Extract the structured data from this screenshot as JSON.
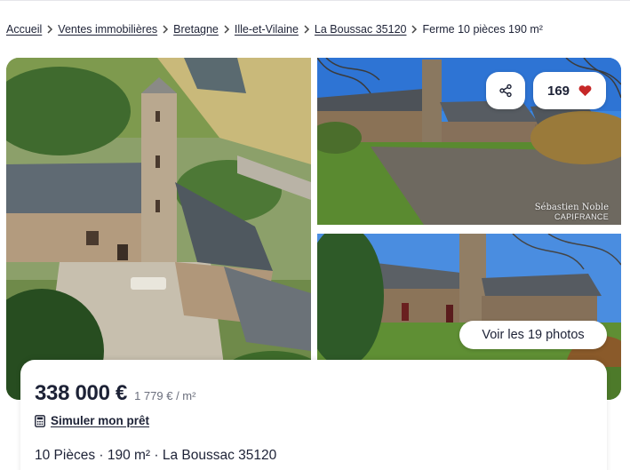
{
  "breadcrumb": {
    "items": [
      {
        "label": "Accueil"
      },
      {
        "label": "Ventes immobilières"
      },
      {
        "label": "Bretagne"
      },
      {
        "label": "Ille-et-Vilaine"
      },
      {
        "label": "La Boussac 35120"
      }
    ],
    "current": "Ferme 10 pièces 190 m²",
    "separator_icon": "chevron-right-icon"
  },
  "gallery": {
    "favorites_count": "169",
    "photos_button_label": "Voir les 19 photos",
    "watermark": {
      "line1": "Sébastien Noble",
      "line2": "CAPIFRANCE"
    },
    "share_icon": "share-icon",
    "favorite_icon": "heart-icon",
    "heart_color": "#c62828"
  },
  "listing": {
    "price": "338 000 €",
    "price_per_m2": "1 779 € / m²",
    "simulate_label": "Simuler mon prêt",
    "simulate_icon": "calculator-icon",
    "summary": "10 Pièces · 190 m² · La Boussac 35120"
  }
}
